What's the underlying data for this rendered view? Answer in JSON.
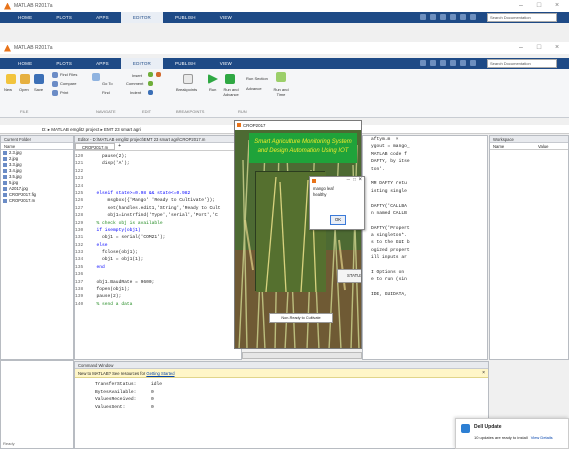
{
  "outer_window": {
    "title": "MATLAB R2017a"
  },
  "inner_window": {
    "title": "MATLAB R2017a"
  },
  "tabs": [
    "HOME",
    "PLOTS",
    "APPS",
    "EDITOR",
    "PUBLISH",
    "VIEW"
  ],
  "search": {
    "placeholder": "Search Documentation"
  },
  "ribbon": {
    "file": [
      "New",
      "Open",
      "Save"
    ],
    "find_files": "Find Files",
    "compare": "Compare",
    "print": "Print",
    "go_to": "Go To",
    "find": "Find",
    "insert": "Insert",
    "comment": "Comment",
    "indent": "Indent",
    "breakpoints": "Breakpoints",
    "run": "Run",
    "run_and_advance": "Run and Advance",
    "run_section": "Run Section",
    "advance": "Advance",
    "run_and_time": "Run and Time",
    "sections": [
      "FILE",
      "NAVIGATE",
      "EDIT",
      "BREAKPOINTS",
      "RUN"
    ]
  },
  "path": "D: ▸ MATLAB emglitz project ▸ EMT 23 smart agri",
  "current_folder": {
    "title": "Current Folder",
    "column": "Name",
    "files": [
      "2.3.jpg",
      "2.jpg",
      "3.3.jpg",
      "3.4.jpg",
      "3.5.jpg",
      "5.jpg",
      "A2017.jpg",
      "CROP2017.fig",
      "CROP2017.m"
    ]
  },
  "editor": {
    "title": "Editor - D:\\MATLAB emglitz project\\EMT 23 smart agri\\CROP2017.m",
    "tab": "CROP2017.m",
    "lines": [
      {
        "n": "120",
        "code": "    pause(2);"
      },
      {
        "n": "121",
        "code": "    disp('A');"
      },
      {
        "n": "122",
        "code": ""
      },
      {
        "n": "123",
        "code": ""
      },
      {
        "n": "124",
        "code": ""
      },
      {
        "n": "125",
        "code": "  elseif state>=0.98 && state<=0.982"
      },
      {
        "n": "126",
        "code": "      msgbox({'Mango' 'Ready to Cultivate'});"
      },
      {
        "n": "127",
        "code": "      set(handles.edit1,'String','Ready to Cult"
      },
      {
        "n": "128",
        "code": "      obj1=instrfind('Type','serial','Port','C"
      },
      {
        "n": "129",
        "code": "  % check obj is available"
      },
      {
        "n": "130",
        "code": "  if isempty(obj1)"
      },
      {
        "n": "131",
        "code": "    obj1 = serial('COM21');"
      },
      {
        "n": "132",
        "code": "  else"
      },
      {
        "n": "133",
        "code": "    fclose(obj1);"
      },
      {
        "n": "134",
        "code": "    obj1 = obj1(1);"
      },
      {
        "n": "135",
        "code": "  end"
      },
      {
        "n": "136",
        "code": ""
      },
      {
        "n": "137",
        "code": "  obj1.BaudRate = 9600;"
      },
      {
        "n": "138",
        "code": "  fopen(obj1);"
      },
      {
        "n": "139",
        "code": "  pause(2);"
      },
      {
        "n": "140",
        "code": "  % send a data"
      }
    ]
  },
  "right_code": {
    "lines": [
      "aftym.m  ×",
      "ygout = mango_",
      "MATLAB code f",
      "DAFTY, by itse",
      "ton'.",
      "",
      "MR DAFTY retu",
      "isting single",
      "",
      "DAFTY('CALLBA",
      "n named CALLB",
      "",
      "DAFTY('Propert",
      "a singleton*.",
      "s to the GUI b",
      "ogized propert",
      "ill inputs ar",
      "",
      "I Options on",
      "e to run (sin",
      "",
      "IDE, GUIDATA,"
    ]
  },
  "workspace": {
    "title": "Workspace",
    "col_name": "Name",
    "col_value": "Value"
  },
  "command_window": {
    "title": "Command Window",
    "notice_prefix": "New to MATLAB? See resources for",
    "notice_link": "Getting Started",
    "lines": [
      {
        "k": "TransferStatus:",
        "v": "idle"
      },
      {
        "k": "BytesAvailable:",
        "v": "0"
      },
      {
        "k": "ValuesReceived:",
        "v": "0"
      },
      {
        "k": "ValuesSent:",
        "v": "0"
      }
    ]
  },
  "gui": {
    "title": "CROP2017",
    "header_line1": "Smart Agriculture Monitoring System",
    "header_line2": "and Design Automation Using IOT",
    "add_button": "ADD",
    "status_button": "STATUS",
    "status_text": "Non-Ready to Cultivate"
  },
  "msgbox": {
    "line1": "mango leaf",
    "line2": "healthy",
    "ok": "OK"
  },
  "notification": {
    "title": "Dell Update",
    "text": "10 updates are ready to install",
    "link": "View Details"
  },
  "status_left": "Ready",
  "colors": {
    "accent": "#1e4a86",
    "gui_header": "#1fa33a",
    "header_text": "#f2ec2c"
  }
}
